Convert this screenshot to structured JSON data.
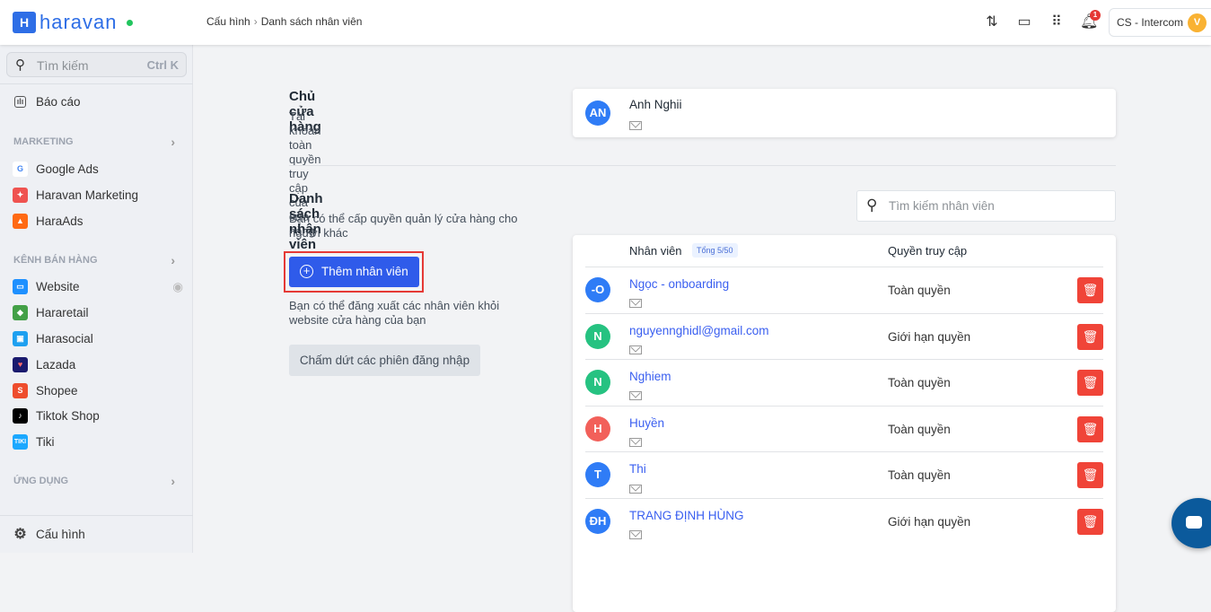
{
  "header": {
    "logo": "haravan",
    "logo_mark": "H",
    "breadcrumb": [
      "Cấu hình",
      "Danh sách nhân viên"
    ],
    "notification_count": "1",
    "store_name": "CS - Intercom",
    "user_initial": "V"
  },
  "sidebar": {
    "search_placeholder": "Tìm kiếm",
    "search_shortcut": "Ctrl K",
    "report": "Báo cáo",
    "sections": [
      {
        "title": "MARKETING",
        "items": [
          "Google Ads",
          "Haravan Marketing",
          "HaraAds"
        ]
      },
      {
        "title": "KÊNH BÁN HÀNG",
        "items": [
          "Website",
          "Hararetail",
          "Harasocial",
          "Lazada",
          "Shopee",
          "Tiktok Shop",
          "Tiki"
        ]
      },
      {
        "title": "ỨNG DỤNG",
        "items": []
      }
    ],
    "settings": "Cấu hình"
  },
  "owner": {
    "title": "Chủ cửa hàng",
    "desc": "Tài khoản toàn quyền truy cập của cửa hàng",
    "initials": "AN",
    "name": "Anh Nghii"
  },
  "staff": {
    "title": "Danh sách nhân viên",
    "desc": "Bạn có thể cấp quyền quản lý cửa hàng cho người khác",
    "add_button": "Thêm nhân viên",
    "logout_desc": "Bạn có thể đăng xuất các nhân viên khỏi website cửa hàng của bạn",
    "logout_button": "Chấm dứt các phiên đăng nhập",
    "search_placeholder": "Tìm kiếm nhân viên",
    "col_staff": "Nhân viên",
    "total_badge": "Tổng 5/50",
    "col_access": "Quyền truy cập",
    "rows": [
      {
        "initials": "-O",
        "name": "Ngọc - onboarding",
        "access": "Toàn quyền",
        "color": "#2f7cf6"
      },
      {
        "initials": "N",
        "name": "nguyennghidl@gmail.com",
        "access": "Giới hạn quyền",
        "color": "#26c281"
      },
      {
        "initials": "N",
        "name": "Nghiem",
        "access": "Toàn quyền",
        "color": "#26c281"
      },
      {
        "initials": "H",
        "name": "Huyền",
        "access": "Toàn quyền",
        "color": "#f2605a"
      },
      {
        "initials": "T",
        "name": "Thi",
        "access": "Toàn quyền",
        "color": "#2f7cf6"
      },
      {
        "initials": "ĐH",
        "name": "TRANG ĐỊNH HÙNG",
        "access": "Giới hạn quyền",
        "color": "#2f7cf6"
      }
    ]
  }
}
